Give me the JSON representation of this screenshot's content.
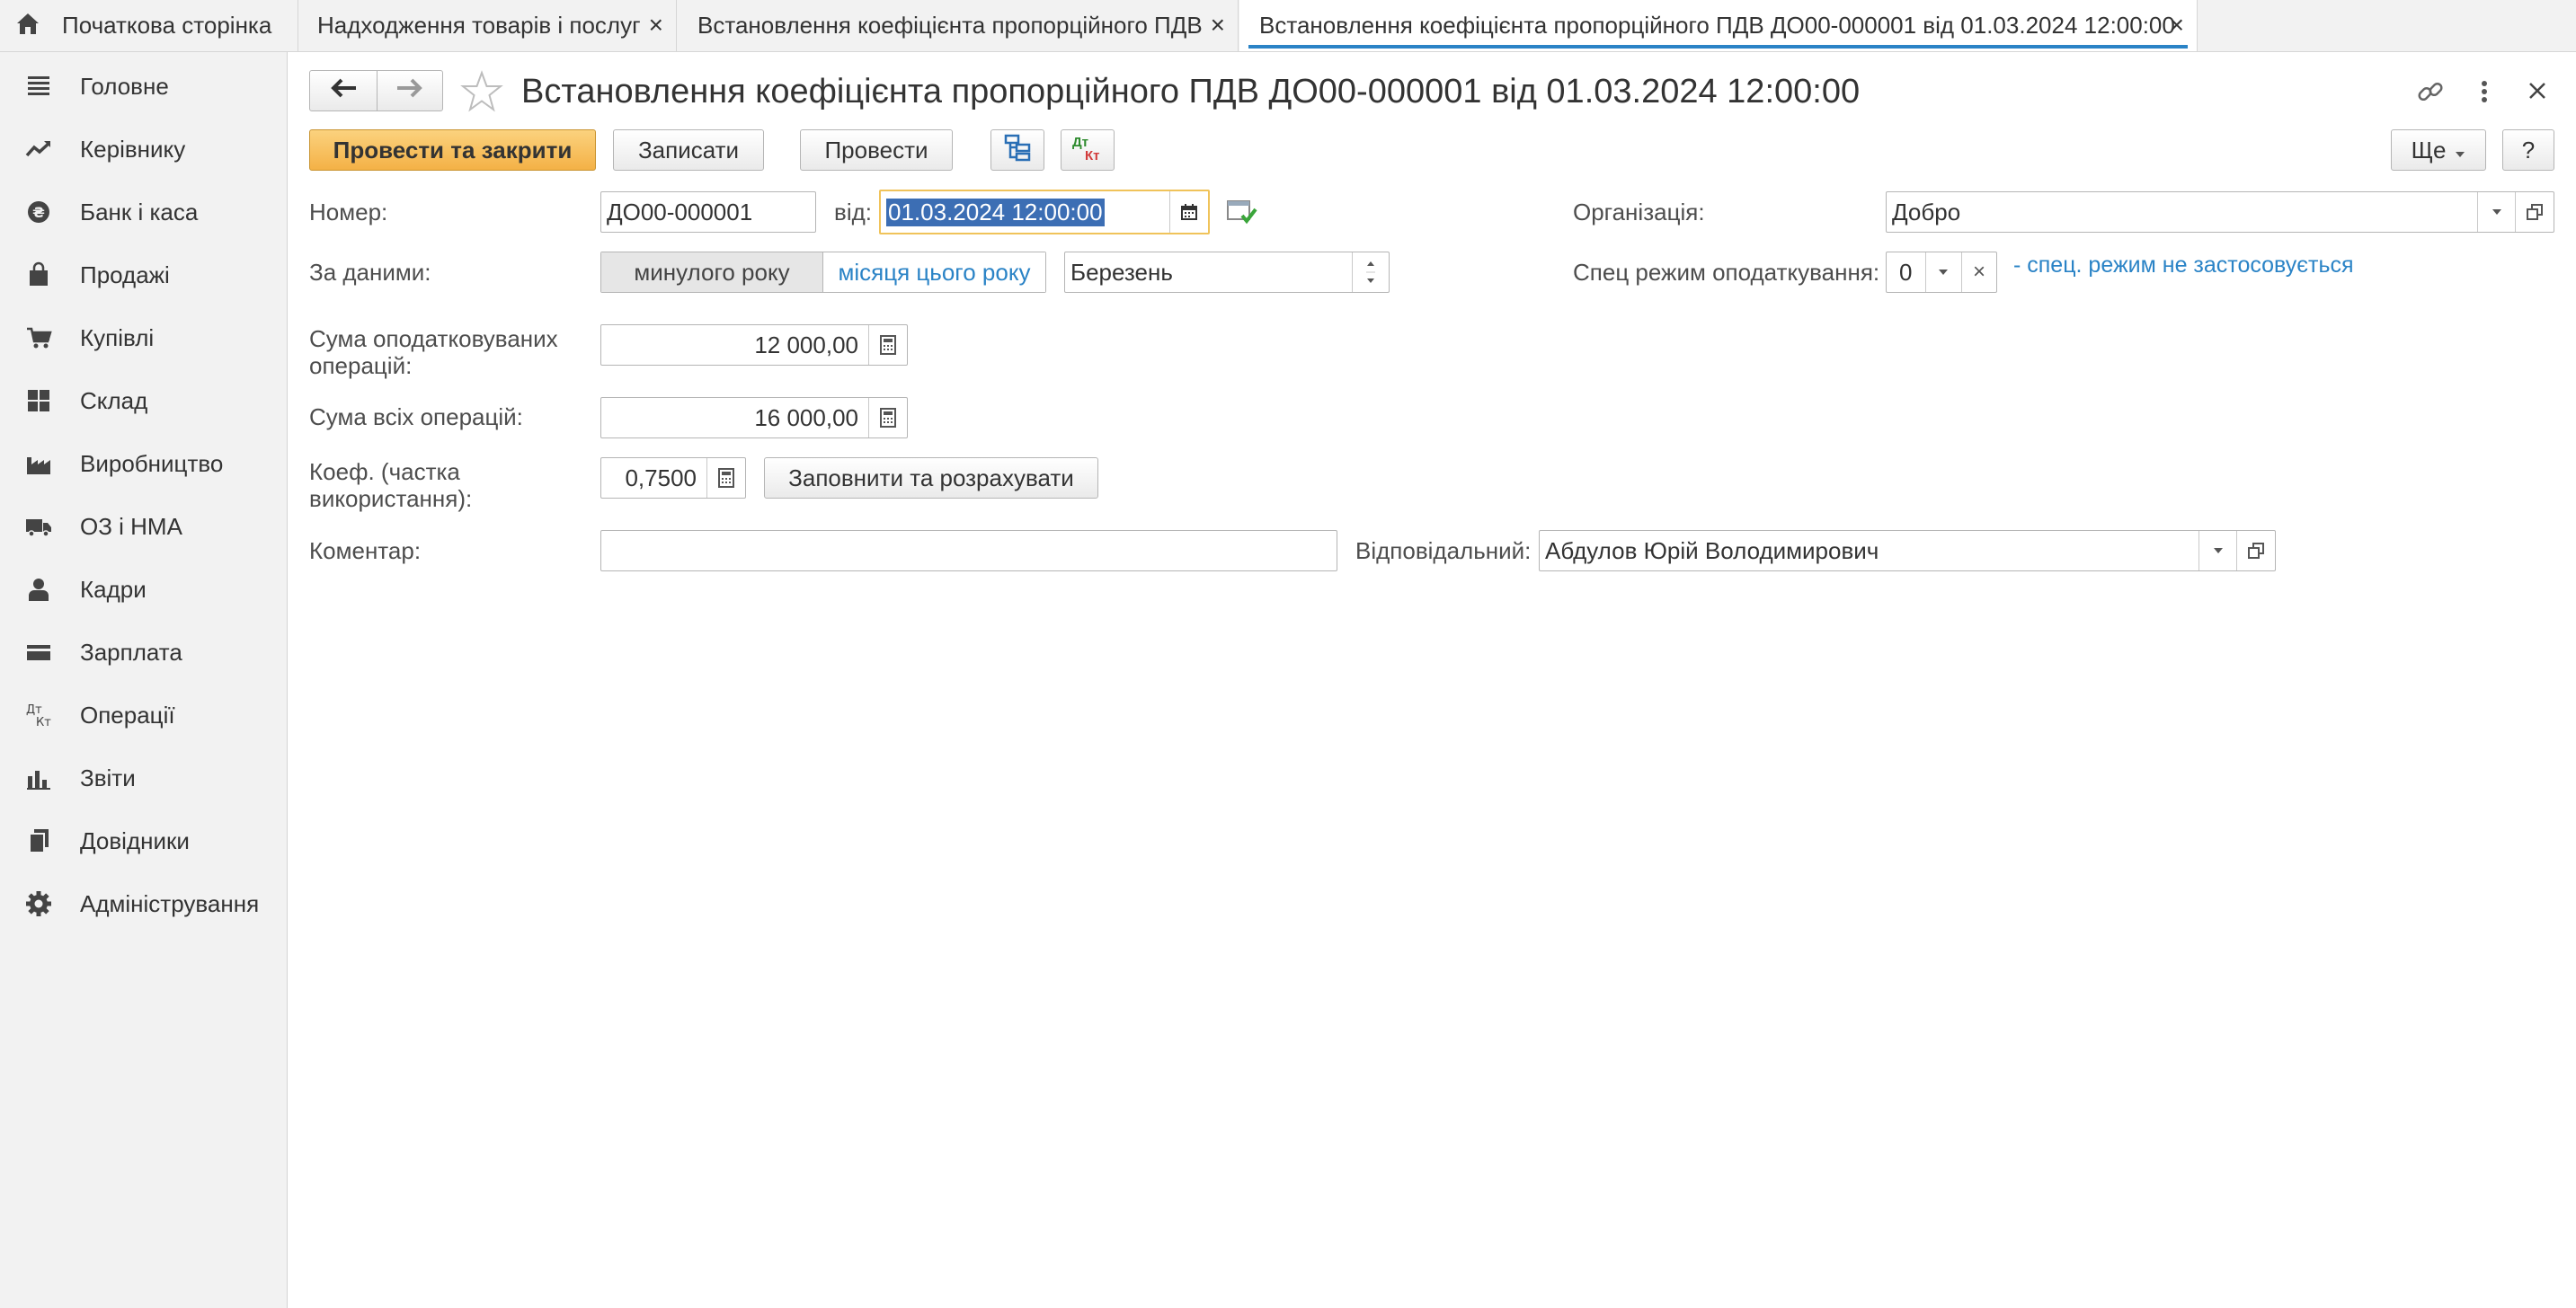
{
  "tabs": [
    {
      "label": "Початкова сторінка"
    },
    {
      "label": "Надходження товарів і послуг"
    },
    {
      "label": "Встановлення коефіцієнта пропорційного ПДВ"
    },
    {
      "label": "Встановлення коефіцієнта пропорційного ПДВ ДО00-000001 від 01.03.2024 12:00:00"
    }
  ],
  "sidebar": {
    "items": [
      {
        "label": "Головне",
        "icon": "menu-lines-icon"
      },
      {
        "label": "Керівнику",
        "icon": "trend-icon"
      },
      {
        "label": "Банк і каса",
        "icon": "coin-icon"
      },
      {
        "label": "Продажі",
        "icon": "shopping-bag-icon"
      },
      {
        "label": "Купівлі",
        "icon": "cart-icon"
      },
      {
        "label": "Склад",
        "icon": "grid-icon"
      },
      {
        "label": "Виробництво",
        "icon": "factory-icon"
      },
      {
        "label": "ОЗ і НМА",
        "icon": "truck-icon"
      },
      {
        "label": "Кадри",
        "icon": "person-icon"
      },
      {
        "label": "Зарплата",
        "icon": "wallet-icon"
      },
      {
        "label": "Операції",
        "icon": "dt-kt-icon"
      },
      {
        "label": "Звіти",
        "icon": "bar-chart-icon"
      },
      {
        "label": "Довідники",
        "icon": "books-icon"
      },
      {
        "label": "Адміністрування",
        "icon": "gear-icon"
      }
    ]
  },
  "form": {
    "title": "Встановлення коефіцієнта пропорційного ПДВ ДО00-000001 від 01.03.2024 12:00:00",
    "toolbar": {
      "post_close": "Провести та закрити",
      "save": "Записати",
      "post": "Провести",
      "more": "Ще",
      "help": "?",
      "dtkt_dt": "Дт",
      "dtkt_kt": "Кт"
    },
    "number_label": "Номер:",
    "number_value": "ДО00-000001",
    "date_label": "від:",
    "date_value": "01.03.2024 12:00:00",
    "org_label": "Організація:",
    "org_value": "Добро",
    "by_data_label": "За даними:",
    "toggle_prev_year": "минулого року",
    "toggle_this_year": "місяця цього року",
    "month_value": "Березень",
    "spec_label": "Спец режим оподаткування:",
    "spec_value": "0",
    "spec_clear": "×",
    "spec_note": "- спец. режим не застосовується",
    "taxable_label_1": "Сума оподатковуваних",
    "taxable_label_2": "операцій:",
    "taxable_value": "12 000,00",
    "total_label": "Сума всіх операцій:",
    "total_value": "16 000,00",
    "coef_label_1": "Коеф. (частка",
    "coef_label_2": "використання):",
    "coef_value": "0,7500",
    "fill_calc": "Заповнити та розрахувати",
    "comment_label": "Коментар:",
    "comment_value": "",
    "resp_label": "Відповідальний:",
    "resp_value": "Абдулов Юрій Володимирович"
  },
  "colors": {
    "accent": "#2a83c6",
    "primary_button": "#f4b146",
    "date_highlight": "#3c6eb4"
  }
}
